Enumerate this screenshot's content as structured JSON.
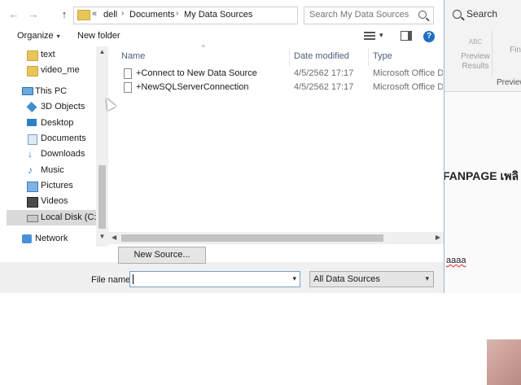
{
  "background_app": {
    "search_label": "Search",
    "preview_abc": "ABC",
    "preview_label_1": "Preview",
    "preview_label_2": "Results",
    "fin_label": "Fin",
    "group_label": "Preview",
    "doc_text_1": "FANPAGE เพลิ",
    "doc_text_2": "aaaa"
  },
  "address_bar": {
    "prefix": "«",
    "crumbs": [
      "dell",
      "Documents",
      "My Data Sources"
    ],
    "separator": "›",
    "refresh": "↻",
    "back": "←",
    "forward": "→",
    "up": "↑"
  },
  "search": {
    "placeholder": "Search My Data Sources"
  },
  "toolbar": {
    "organize_label": "Organize",
    "organize_caret": "▾",
    "new_folder_label": "New folder",
    "view_caret": "▾",
    "help": "?"
  },
  "nav_pane": {
    "items": [
      {
        "label": "text",
        "icon": "folder-icon"
      },
      {
        "label": "video_me",
        "icon": "folder-icon"
      },
      {
        "label": "This PC",
        "icon": "computer-icon"
      },
      {
        "label": "3D Objects",
        "icon": "3d-objects-icon"
      },
      {
        "label": "Desktop",
        "icon": "desktop-icon"
      },
      {
        "label": "Documents",
        "icon": "documents-icon"
      },
      {
        "label": "Downloads",
        "icon": "download-arrow-icon"
      },
      {
        "label": "Music",
        "icon": "music-note-icon"
      },
      {
        "label": "Pictures",
        "icon": "pictures-icon"
      },
      {
        "label": "Videos",
        "icon": "videos-icon"
      },
      {
        "label": "Local Disk (C:)",
        "icon": "drive-icon"
      },
      {
        "label": "Network",
        "icon": "network-icon"
      }
    ],
    "selected": "Local Disk (C:)",
    "scroll_up": "▲",
    "scroll_down": "▼"
  },
  "file_list": {
    "sort_caret": "^",
    "columns": [
      "Name",
      "Date modified",
      "Type"
    ],
    "rows": [
      {
        "name": "+Connect to New Data Source",
        "date": "4/5/2562 17:17",
        "type": "Microsoft Office D..."
      },
      {
        "name": "+NewSQLServerConnection",
        "date": "4/5/2562 17:17",
        "type": "Microsoft Office D..."
      }
    ],
    "h_scroll_left": "◀",
    "h_scroll_right": "▶"
  },
  "new_source_label": "New Source...",
  "file_name": {
    "label": "File name:",
    "value": "",
    "dropdown": "▾"
  },
  "file_type": {
    "selected": "All Data Sources",
    "dropdown": "▾"
  },
  "colors": {
    "accent": "#1f6fc5",
    "folder": "#e8c65a",
    "selected_bg": "#d9d9d9"
  }
}
